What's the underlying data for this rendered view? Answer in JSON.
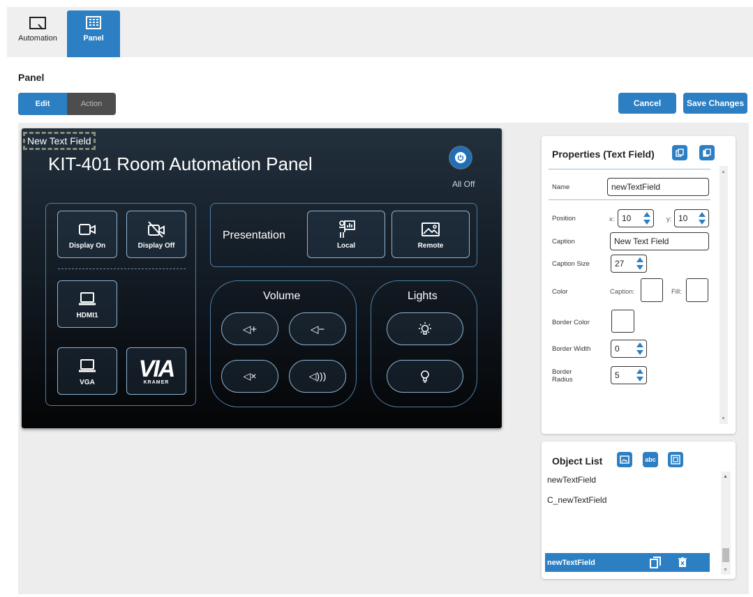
{
  "tabs": [
    {
      "label": "Automation",
      "icon": "automation-icon"
    },
    {
      "label": "Panel",
      "icon": "panel-grid-icon"
    }
  ],
  "page": {
    "title": "Panel"
  },
  "mode": {
    "edit": "Edit",
    "action": "Action"
  },
  "actions": {
    "cancel": "Cancel",
    "save": "Save Changes"
  },
  "panel": {
    "selected_field": "New Text Field",
    "title": "KIT-401 Room Automation Panel",
    "all_off": "All Off",
    "buttons": {
      "display_on": "Display On",
      "display_off": "Display Off",
      "hdmi1": "HDMI1",
      "vga": "VGA",
      "local": "Local",
      "remote": "Remote"
    },
    "presentation": "Presentation",
    "volume": "Volume",
    "lights": "Lights",
    "logo": {
      "main": "VIA",
      "sub": "KRAMER"
    }
  },
  "properties": {
    "title": "Properties (Text Field)",
    "name_label": "Name",
    "name_value": "newTextField",
    "position_label": "Position",
    "x_label": "x:",
    "x_value": "10",
    "y_label": "y:",
    "y_value": "10",
    "caption_label": "Caption",
    "caption_value": "New Text Field",
    "caption_size_label": "Caption Size",
    "caption_size_value": "27",
    "color_label": "Color",
    "caption_color_label": "Caption:",
    "fill_color_label": "Fill:",
    "border_color_label": "Border Color",
    "border_width_label": "Border Width",
    "border_width_value": "0",
    "border_radius_label_1": "Border",
    "border_radius_label_2": "Radius",
    "border_radius_value": "5"
  },
  "object_list": {
    "title": "Object List",
    "items": [
      "newTextField",
      "C_newTextField"
    ],
    "selected": "newTextField"
  },
  "colors": {
    "accent": "#2c7fc3",
    "panel_bg": "#111820",
    "tile_border": "#8fb4d1"
  }
}
